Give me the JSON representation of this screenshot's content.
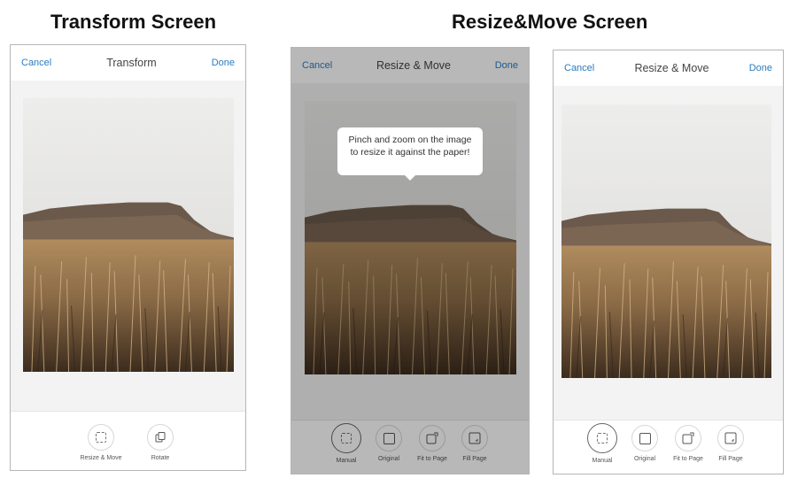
{
  "headings": {
    "transform": "Transform Screen",
    "resize_move": "Resize&Move Screen"
  },
  "screen1": {
    "cancel": "Cancel",
    "title": "Transform",
    "done": "Done",
    "tools": [
      {
        "label": "Resize & Move",
        "icon": "resize-move-icon"
      },
      {
        "label": "Rotate",
        "icon": "rotate-icon"
      }
    ]
  },
  "screen2": {
    "cancel": "Cancel",
    "title": "Resize & Move",
    "done": "Done",
    "tooltip_line1": "Pinch and zoom on the image",
    "tooltip_line2": "to resize it against the paper!",
    "tools": [
      {
        "label": "Manual",
        "icon": "manual-icon"
      },
      {
        "label": "Original",
        "icon": "original-icon"
      },
      {
        "label": "Fit to Page",
        "icon": "fit-to-page-icon"
      },
      {
        "label": "Fill Page",
        "icon": "fill-page-icon"
      }
    ]
  },
  "screen3": {
    "cancel": "Cancel",
    "title": "Resize & Move",
    "done": "Done",
    "tools": [
      {
        "label": "Manual",
        "icon": "manual-icon"
      },
      {
        "label": "Original",
        "icon": "original-icon"
      },
      {
        "label": "Fit to Page",
        "icon": "fit-to-page-icon"
      },
      {
        "label": "Fill Page",
        "icon": "fill-page-icon"
      }
    ]
  },
  "colors": {
    "accent": "#2a7cc0",
    "sky": "#e9e9e9",
    "mountain": "#6e5c4c",
    "grass": "#a07c52"
  }
}
